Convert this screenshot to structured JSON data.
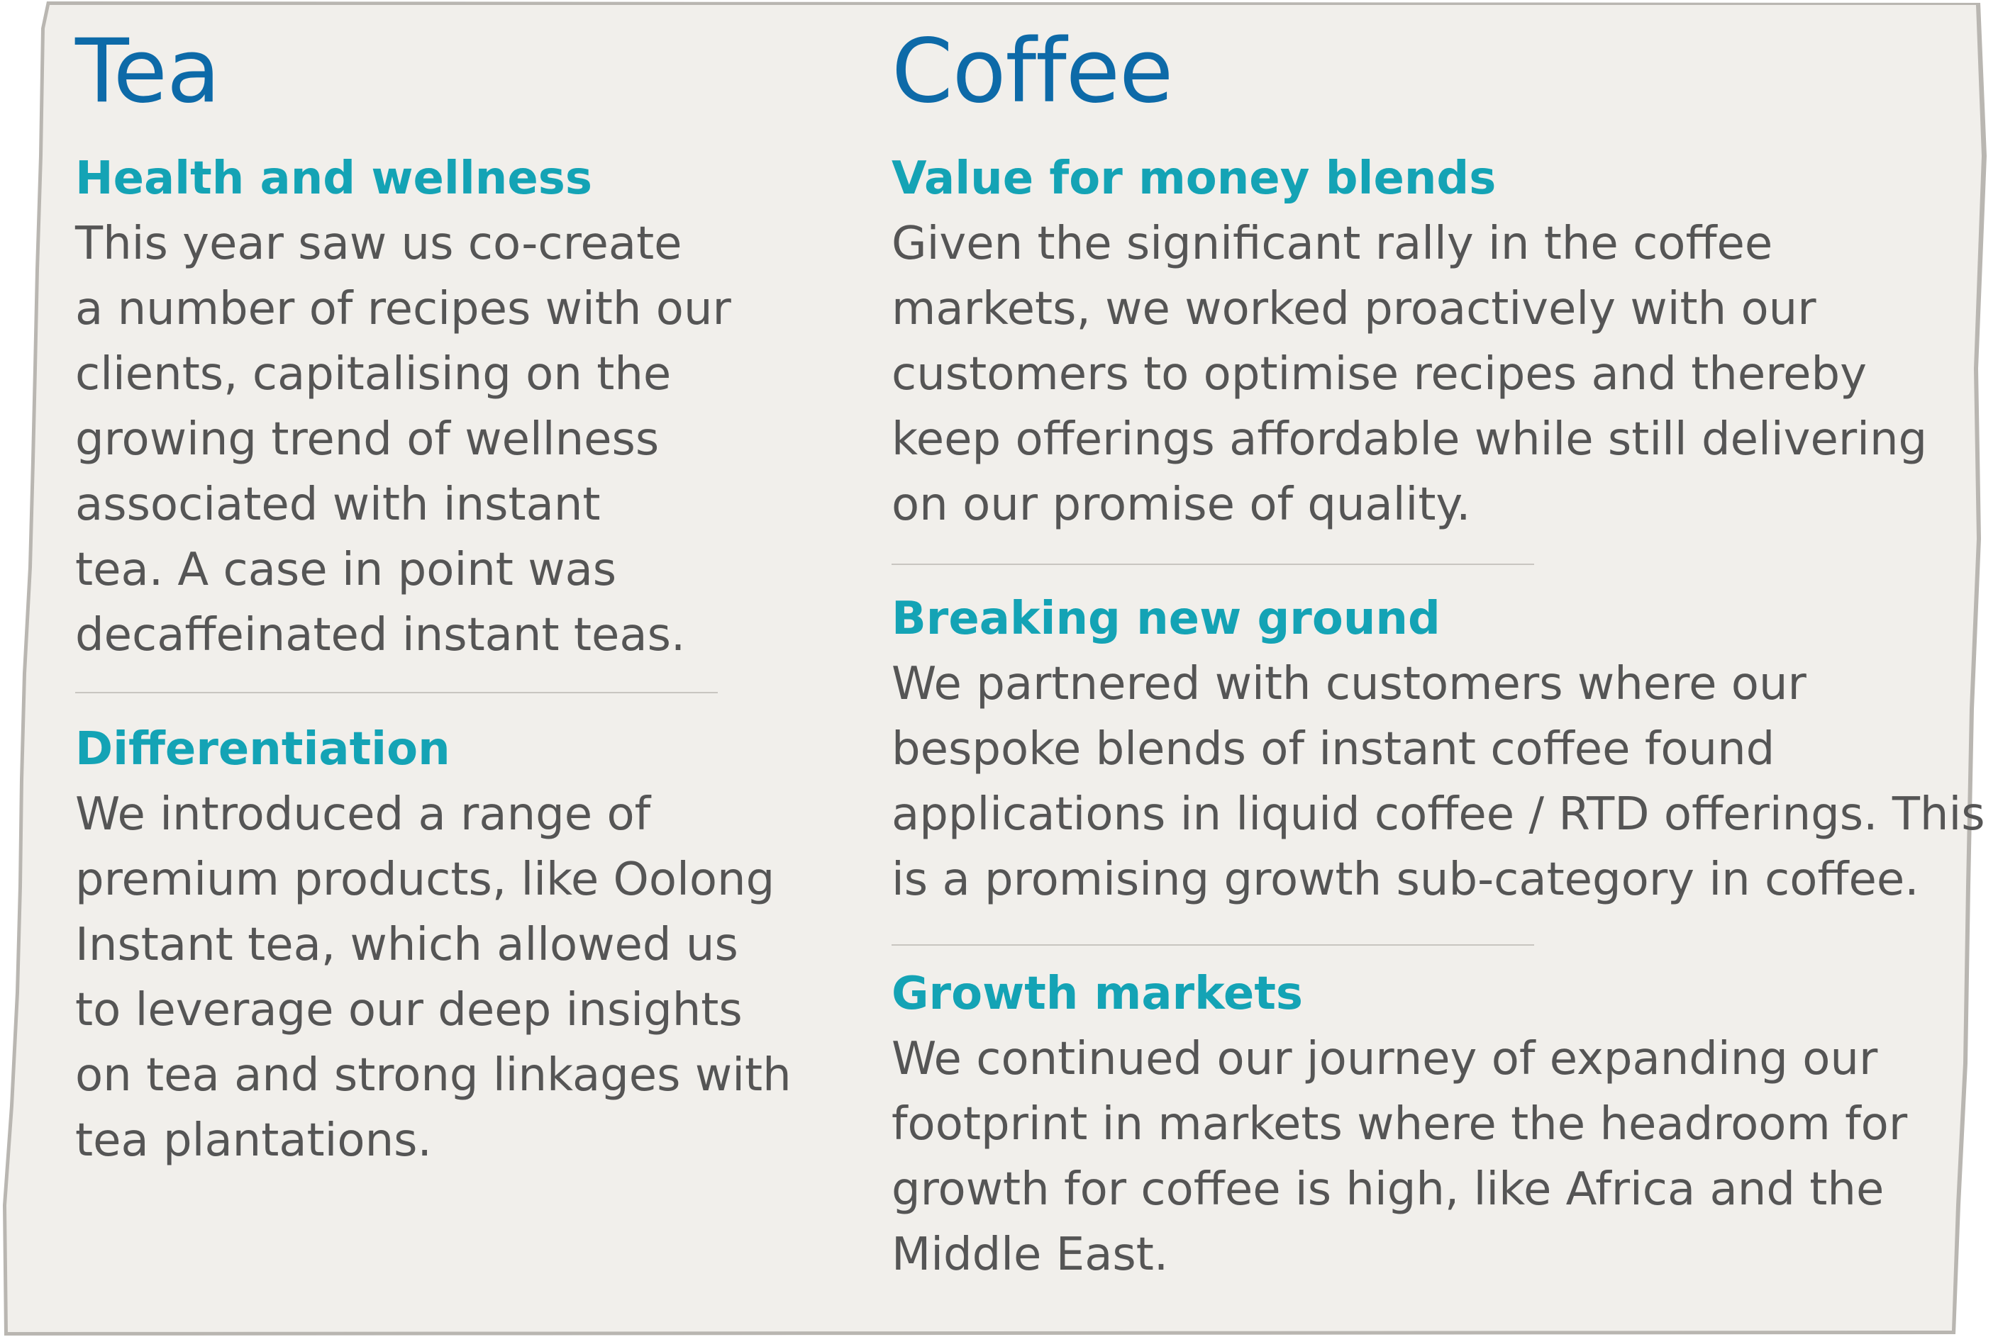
{
  "tea": {
    "title": "Tea",
    "sections": [
      {
        "heading": "Health and wellness",
        "lines": [
          "This year saw us co-create",
          "a number of recipes with our",
          "clients, capitalising on the",
          "growing trend of wellness",
          "associated with instant",
          "tea. A case in point was",
          "decaffeinated instant teas."
        ]
      },
      {
        "heading": "Differentiation",
        "lines": [
          "We introduced a range of",
          "premium products, like Oolong",
          "Instant tea, which allowed us",
          "to leverage our deep insights",
          "on tea and strong linkages with",
          "tea plantations."
        ]
      }
    ]
  },
  "coffee": {
    "title": "Coffee",
    "sections": [
      {
        "heading": "Value for money blends",
        "lines": [
          "Given the significant rally in the coffee",
          "markets, we worked proactively with our",
          "customers to optimise recipes and thereby",
          "keep offerings affordable while still delivering",
          "on our promise of quality."
        ]
      },
      {
        "heading": "Breaking new ground",
        "lines": [
          "We partnered with customers where our",
          "bespoke blends of instant coffee found",
          "applications in liquid coffee / RTD offerings. This",
          "is a promising growth sub-category in coffee."
        ]
      },
      {
        "heading": "Growth markets",
        "lines": [
          "We continued our journey of expanding our",
          "footprint in markets where the headroom for",
          "growth for coffee is high, like Africa and the",
          "Middle East."
        ]
      }
    ]
  },
  "colors": {
    "paper": "#f1efeb",
    "paper_edge": "#b9b6b1",
    "title": "#0d6aa8",
    "heading": "#14a3b5",
    "body": "#555555",
    "rule": "#c8c5c0"
  }
}
